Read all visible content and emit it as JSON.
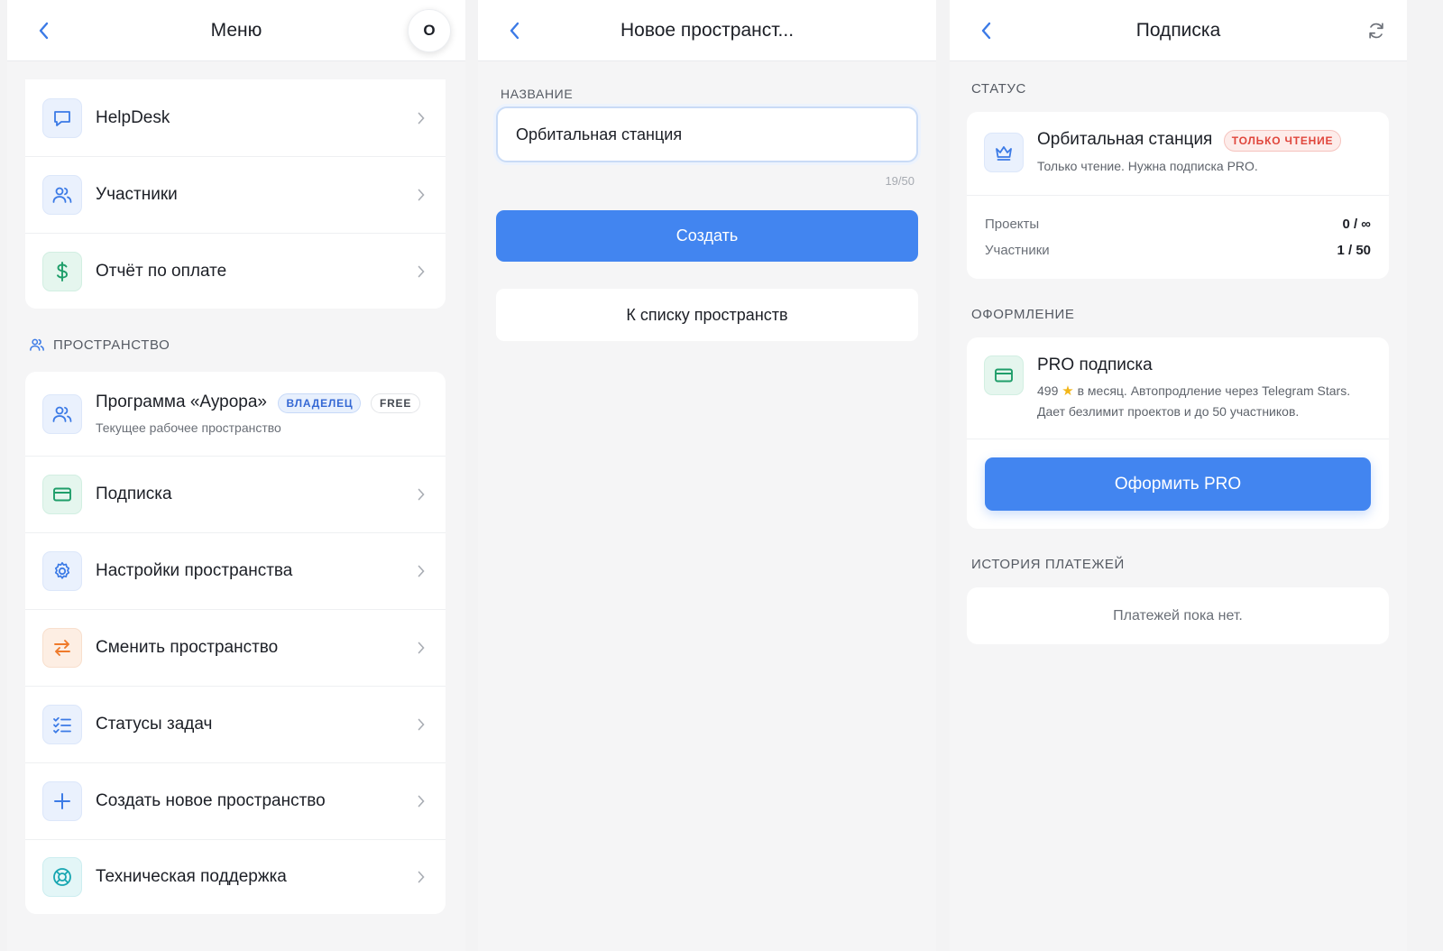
{
  "menu_screen": {
    "title": "Меню",
    "avatar_initial": "О",
    "top_items": [
      {
        "label": "HelpDesk",
        "icon": "chat-icon"
      },
      {
        "label": "Участники",
        "icon": "users-icon"
      },
      {
        "label": "Отчёт по оплате",
        "icon": "dollar-icon"
      }
    ],
    "section_title": "ПРОСТРАНСТВО",
    "workspace": {
      "name": "Программа «Аурора»",
      "role_badge": "ВЛАДЕЛЕЦ",
      "plan_badge": "FREE",
      "subtitle": "Текущее рабочее пространство"
    },
    "workspace_items": [
      {
        "label": "Подписка",
        "icon": "card-icon"
      },
      {
        "label": "Настройки пространства",
        "icon": "gear-icon"
      },
      {
        "label": "Сменить пространство",
        "icon": "swap-icon"
      },
      {
        "label": "Статусы задач",
        "icon": "checklist-icon"
      },
      {
        "label": "Создать новое пространство",
        "icon": "plus-icon"
      },
      {
        "label": "Техническая поддержка",
        "icon": "lifebuoy-icon"
      }
    ]
  },
  "new_space_screen": {
    "title": "Новое пространст...",
    "field_label": "НАЗВАНИЕ",
    "name_value": "Орбитальная станция",
    "counter": "19/50",
    "create_label": "Создать",
    "back_to_list_label": "К списку пространств"
  },
  "subscription_screen": {
    "title": "Подписка",
    "status_section": "СТАТУС",
    "status": {
      "name": "Орбитальная станция",
      "badge": "ТОЛЬКО ЧТЕНИЕ",
      "description": "Только чтение. Нужна подписка PRO."
    },
    "stats": [
      {
        "label": "Проекты",
        "value": "0 / ∞"
      },
      {
        "label": "Участники",
        "value": "1 / 50"
      }
    ],
    "design_section": "ОФОРМЛЕНИЕ",
    "pro": {
      "title": "PRO подписка",
      "price": "499",
      "price_suffix": "в месяц. Автопродление через Telegram Stars.",
      "benefits": "Дает безлимит проектов и до 50 участников.",
      "button_label": "Оформить PRO"
    },
    "history_section": "ИСТОРИЯ ПЛАТЕЖЕЙ",
    "history_empty": "Платежей пока нет."
  },
  "colors": {
    "accent": "#4285f0",
    "background": "#f5f5f6",
    "danger": "#e0463c",
    "success": "#1f9e6a",
    "warning": "#ef7a2a",
    "star": "#f2b619"
  }
}
